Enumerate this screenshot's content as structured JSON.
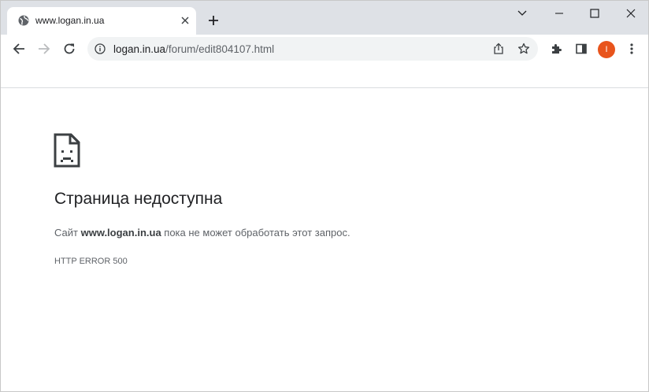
{
  "tab": {
    "title": "www.logan.in.ua",
    "favicon": "globe-icon"
  },
  "window_controls": {
    "tab_search": "chevron-down-icon",
    "minimize": "minimize-icon",
    "maximize": "maximize-icon",
    "close": "close-icon"
  },
  "toolbar": {
    "back": "back-arrow-icon",
    "forward": "forward-arrow-icon",
    "reload": "reload-icon",
    "address": {
      "host": "logan.in.ua",
      "path": "/forum/edit804107.html"
    },
    "share": "share-icon",
    "bookmark": "star-icon",
    "extensions": "puzzle-icon",
    "side_panel": "side-panel-icon",
    "profile_initial": "I",
    "menu": "kebab-menu-icon"
  },
  "error_page": {
    "icon": "sad-page-icon",
    "title": "Страница недоступна",
    "description_prefix": "Сайт ",
    "description_host": "www.logan.in.ua",
    "description_suffix": " пока не может обработать этот запрос.",
    "code": "HTTP ERROR 500"
  },
  "colors": {
    "tabstrip_bg": "#dee1e6",
    "omnibox_bg": "#f1f3f4",
    "avatar_bg": "#e8541c",
    "text_primary": "#202124",
    "text_secondary": "#5f6368"
  }
}
